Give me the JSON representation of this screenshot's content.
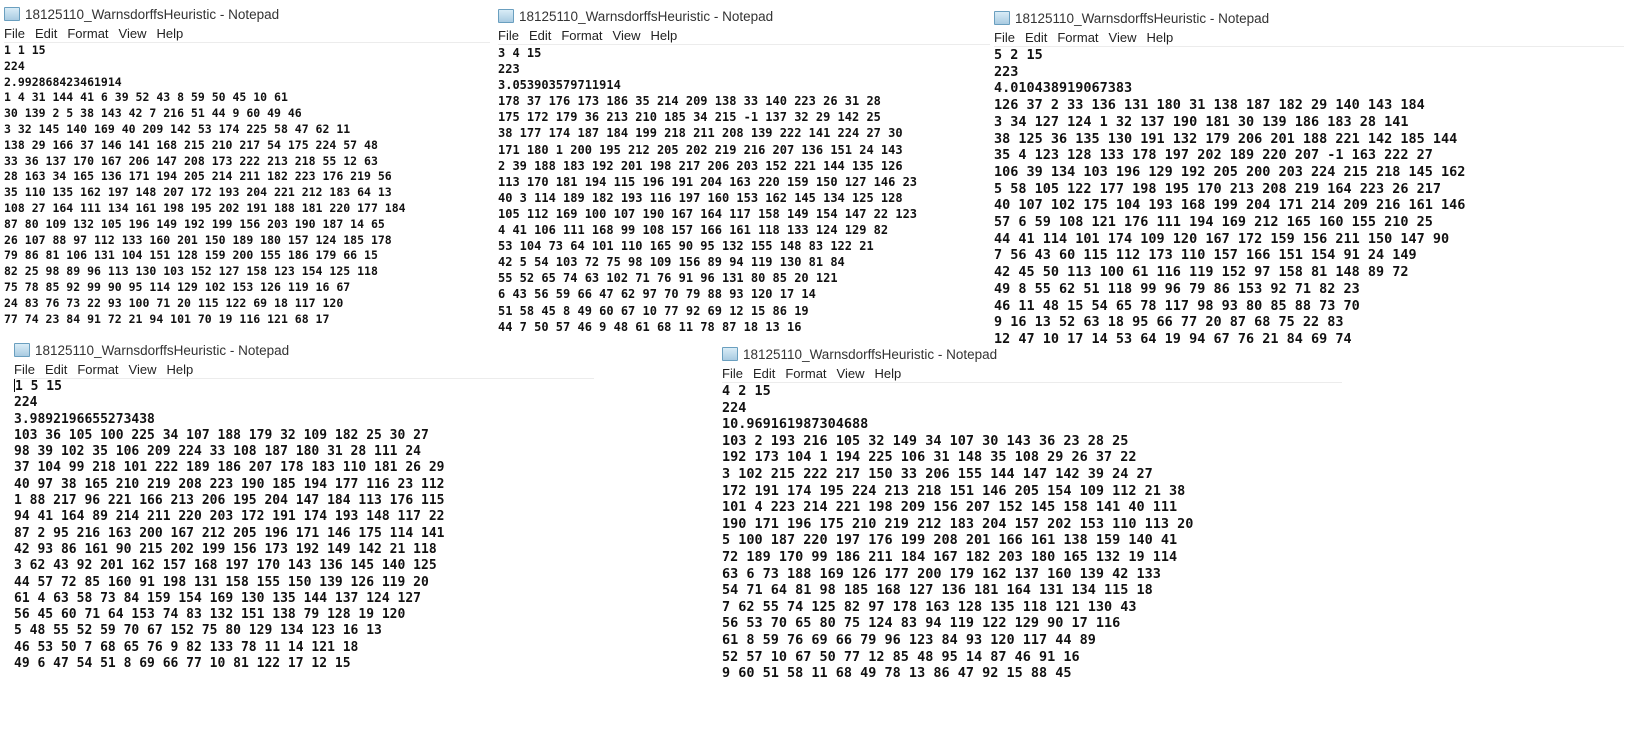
{
  "menu": [
    "File",
    "Edit",
    "Format",
    "View",
    "Help"
  ],
  "windows": [
    {
      "title": "18125110_WarnsdorffsHeuristic - Notepad",
      "lines": [
        "1 1 15",
        "224",
        "2.992868423461914",
        "1 4 31 144 41 6 39 52 43 8 59 50 45 10 61",
        "30 139 2 5 38 143 42 7 216 51 44 9 60 49 46",
        "3 32 145 140 169 40 209 142 53 174 225 58 47 62 11",
        "138 29 166 37 146 141 168 215 210 217 54 175 224 57 48",
        "33 36 137 170 167 206 147 208 173 222 213 218 55 12 63",
        "28 163 34 165 136 171 194 205 214 211 182 223 176 219 56",
        "35 110 135 162 197 148 207 172 193 204 221 212 183 64 13",
        "108 27 164 111 134 161 198 195 202 191 188 181 220 177 184",
        "87 80 109 132 105 196 149 192 199 156 203 190 187 14 65",
        "26 107 88 97 112 133 160 201 150 189 180 157 124 185 178",
        "79 86 81 106 131 104 151 128 159 200 155 186 179 66 15",
        "82 25 98 89 96 113 130 103 152 127 158 123 154 125 118",
        "75 78 85 92 99 90 95 114 129 102 153 126 119 16 67",
        "24 83 76 73 22 93 100 71 20 115 122 69 18 117 120",
        "77 74 23 84 91 72 21 94 101 70 19 116 121 68 17"
      ]
    },
    {
      "title": "18125110_WarnsdorffsHeuristic - Notepad",
      "lines": [
        "3 4 15",
        "223",
        "3.053903579711914",
        "178 37 176 173 186 35 214 209 138 33 140 223 26 31 28",
        "175 172 179 36 213 210 185 34 215 -1 137 32 29 142 25",
        "38 177 174 187 184 199 218 211 208 139 222 141 224 27 30",
        "171 180 1 200 195 212 205 202 219 216 207 136 151 24 143",
        "2 39 188 183 192 201 198 217 206 203 152 221 144 135 126",
        "113 170 181 194 115 196 191 204 163 220 159 150 127 146 23",
        "40 3 114 189 182 193 116 197 160 153 162 145 134 125 128",
        "105 112 169 100 107 190 167 164 117 158 149 154 147 22 123",
        "4 41 106 111 168 99 108 157 166 161 118 133 124 129 82",
        "53 104 73 64 101 110 165 90 95 132 155 148 83 122 21",
        "42 5 54 103 72 75 98 109 156 89 94 119 130 81 84",
        "55 52 65 74 63 102 71 76 91 96 131 80 85 20 121",
        "6 43 56 59 66 47 62 97 70 79 88 93 120 17 14",
        "51 58 45 8 49 60 67 10 77 92 69 12 15 86 19",
        "44 7 50 57 46 9 48 61 68 11 78 87 18 13 16"
      ]
    },
    {
      "title": "18125110_WarnsdorffsHeuristic - Notepad",
      "lines": [
        "5 2 15",
        "223",
        "4.010438919067383",
        "126 37 2 33 136 131 180 31 138 187 182 29 140 143 184",
        "3 34 127 124 1 32 137 190 181 30 139 186 183 28 141",
        "38 125 36 135 130 191 132 179 206 201 188 221 142 185 144",
        "35 4 123 128 133 178 197 202 189 220 207 -1 163 222 27",
        "106 39 134 103 196 129 192 205 200 203 224 215 218 145 162",
        "5 58 105 122 177 198 195 170 213 208 219 164 223 26 217",
        "40 107 102 175 104 193 168 199 204 171 214 209 216 161 146",
        "57 6 59 108 121 176 111 194 169 212 165 160 155 210 25",
        "44 41 114 101 174 109 120 167 172 159 156 211 150 147 90",
        "7 56 43 60 115 112 173 110 157 166 151 154 91 24 149",
        "42 45 50 113 100 61 116 119 152 97 158 81 148 89 72",
        "49 8 55 62 51 118 99 96 79 86 153 92 71 82 23",
        "46 11 48 15 54 65 78 117 98 93 80 85 88 73 70",
        "9 16 13 52 63 18 95 66 77 20 87 68 75 22 83",
        "12 47 10 17 14 53 64 19 94 67 76 21 84 69 74"
      ]
    },
    {
      "title": "18125110_WarnsdorffsHeuristic - Notepad",
      "lines": [
        "1 5 15",
        "224",
        "3.9892196655273438",
        "103 36 105 100 225 34 107 188 179 32 109 182 25 30 27",
        "98 39 102 35 106 209 224 33 108 187 180 31 28 111 24",
        "37 104 99 218 101 222 189 186 207 178 183 110 181 26 29",
        "40 97 38 165 210 219 208 223 190 185 194 177 116 23 112",
        "1 88 217 96 221 166 213 206 195 204 147 184 113 176 115",
        "94 41 164 89 214 211 220 203 172 191 174 193 148 117 22",
        "87 2 95 216 163 200 167 212 205 196 171 146 175 114 141",
        "42 93 86 161 90 215 202 199 156 173 192 149 142 21 118",
        "3 62 43 92 201 162 157 168 197 170 143 136 145 140 125",
        "44 57 72 85 160 91 198 131 158 155 150 139 126 119 20",
        "61 4 63 58 73 84 159 154 169 130 135 144 137 124 127",
        "56 45 60 71 64 153 74 83 132 151 138 79 128 19 120",
        "5 48 55 52 59 70 67 152 75 80 129 134 123 16 13",
        "46 53 50 7 68 65 76 9 82 133 78 11 14 121 18",
        "49 6 47 54 51 8 69 66 77 10 81 122 17 12 15"
      ]
    },
    {
      "title": "18125110_WarnsdorffsHeuristic - Notepad",
      "lines": [
        "4 2 15",
        "224",
        "10.969161987304688",
        "103 2 193 216 105 32 149 34 107 30 143 36 23 28 25",
        "192 173 104 1 194 225 106 31 148 35 108 29 26 37 22",
        "3 102 215 222 217 150 33 206 155 144 147 142 39 24 27",
        "172 191 174 195 224 213 218 151 146 205 154 109 112 21 38",
        "101 4 223 214 221 198 209 156 207 152 145 158 141 40 111",
        "190 171 196 175 210 219 212 183 204 157 202 153 110 113 20",
        "5 100 187 220 197 176 199 208 201 166 161 138 159 140 41",
        "72 189 170 99 186 211 184 167 182 203 180 165 132 19 114",
        "63 6 73 188 169 126 177 200 179 162 137 160 139 42 133",
        "54 71 64 81 98 185 168 127 136 181 164 131 134 115 18",
        "7 62 55 74 125 82 97 178 163 128 135 118 121 130 43",
        "56 53 70 65 80 75 124 83 94 119 122 129 90 17 116",
        "61 8 59 76 69 66 79 96 123 84 93 120 117 44 89",
        "52 57 10 67 50 77 12 85 48 95 14 87 46 91 16",
        "9 60 51 58 11 68 49 78 13 86 47 92 15 88 45"
      ]
    }
  ]
}
